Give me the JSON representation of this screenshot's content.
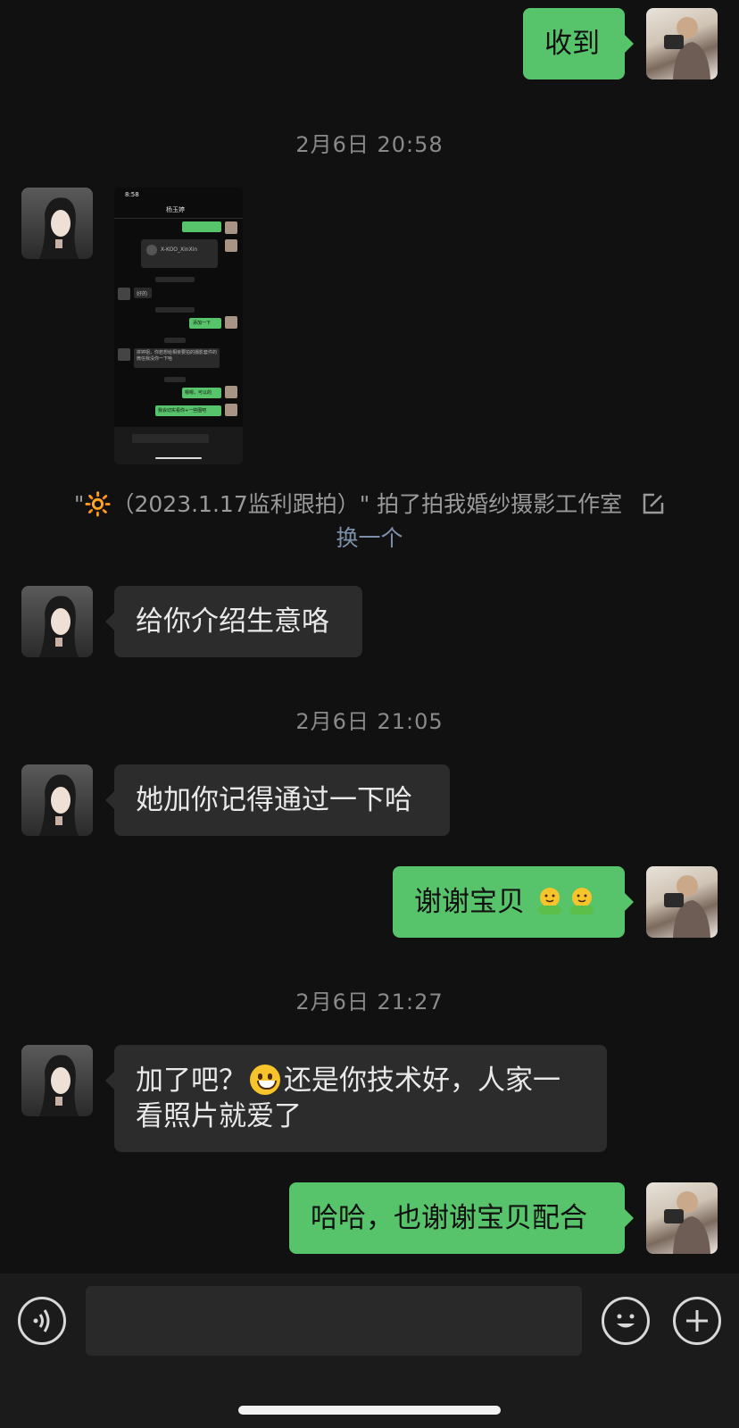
{
  "messages": {
    "m1": {
      "text": "收到"
    },
    "ts1": "2月6日 20:58",
    "pat": {
      "prefix": "\"🔆（2023.1.17监利跟拍）\" 拍了拍我婚纱摄影工作室",
      "change": "换一个"
    },
    "m2": {
      "text": "给你介绍生意咯"
    },
    "ts2": "2月6日 21:05",
    "m3": {
      "text": "她加你记得通过一下哈"
    },
    "m4": {
      "text": "谢谢宝贝"
    },
    "ts3": "2月6日 21:27",
    "m5": {
      "line1a": "加了吧？",
      "line1b": "还是你技术好，人家一",
      "line2": "看照片就爱了"
    },
    "m6": {
      "text": "哈哈，也谢谢宝贝配合"
    }
  },
  "screenshot_thumb": {
    "time": "8:58",
    "contact": "杨玉婷",
    "card_name": "X-KOO_XinXin",
    "reply": "好的",
    "sent1": "添加一下",
    "long_text": "拼婷姐，你若想给相亲要拍的摄影套件的微信我没你一下哈",
    "sent2": "嗯嗯，可以的",
    "sent3": "我会切实看你+一些图吧"
  },
  "input": {
    "value": ""
  },
  "icons": {
    "voice": "voice-icon",
    "emoji": "emoji-icon",
    "plus": "plus-icon"
  },
  "colors": {
    "green": "#57c36a",
    "gray_bubble": "#2c2c2c",
    "bg": "#111111"
  }
}
